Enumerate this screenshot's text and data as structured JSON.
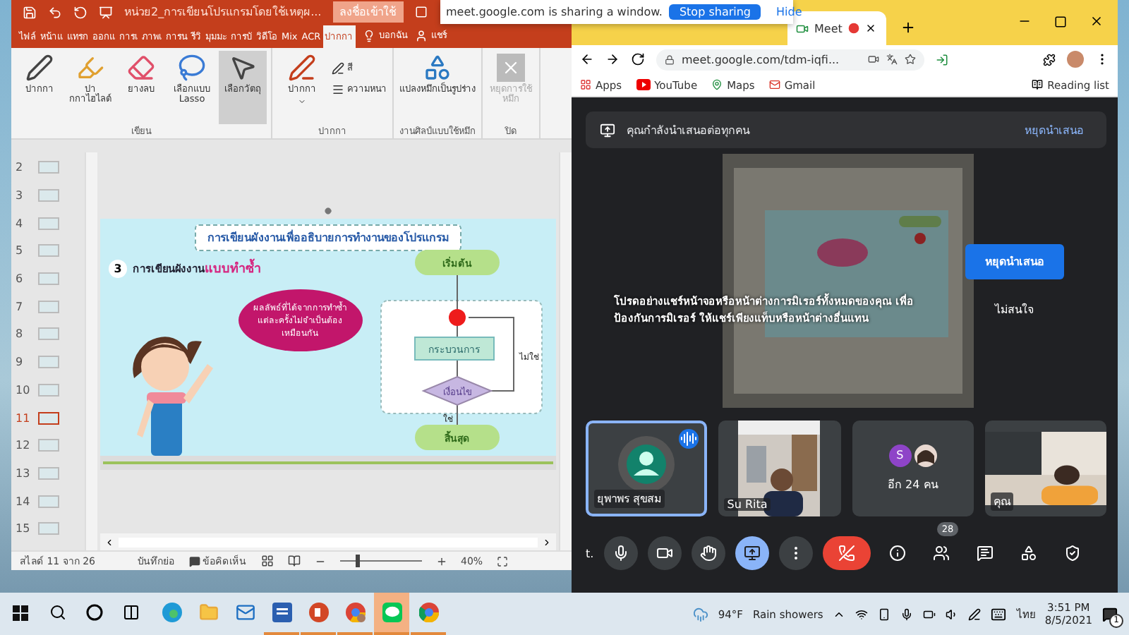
{
  "powerpoint": {
    "file_title": "หน่วย2_การเขียนโปรแกรมโดยใช้เหตุผ...",
    "sign_in": "ลงชื่อเข้าใช้",
    "tabs": [
      {
        "label": "ไฟล์",
        "selected": false
      },
      {
        "label": "หน้าแ",
        "selected": false
      },
      {
        "label": "แทรก",
        "selected": false
      },
      {
        "label": "ออกแ",
        "selected": false
      },
      {
        "label": "การเ",
        "selected": false
      },
      {
        "label": "ภาพเ",
        "selected": false
      },
      {
        "label": "การน",
        "selected": false
      },
      {
        "label": "รีวิ",
        "selected": false
      },
      {
        "label": "มุมมะ",
        "selected": false
      },
      {
        "label": "การบั",
        "selected": false
      },
      {
        "label": "วิดีโอ",
        "selected": false
      },
      {
        "label": "Mix",
        "selected": false
      },
      {
        "label": "ACR",
        "selected": false
      },
      {
        "label": "ปากกา",
        "selected": true
      }
    ],
    "tell_me": "บอกฉัน",
    "share": "แชร์",
    "ribbon_groups": [
      {
        "name": "เขียน",
        "tools": [
          {
            "label": "ปากกา",
            "kind": "pen",
            "selected": false,
            "disabled": false
          },
          {
            "label": "ปากกาไฮไลต์",
            "kind": "highlighter",
            "selected": false,
            "disabled": false
          },
          {
            "label": "ยางลบ",
            "kind": "eraser",
            "selected": false,
            "disabled": false
          },
          {
            "label": "เลือกแบบ Lasso",
            "kind": "lasso",
            "selected": false,
            "disabled": false
          },
          {
            "label": "เลือกวัตถุ",
            "kind": "select",
            "selected": true,
            "disabled": false
          }
        ]
      },
      {
        "name": "ปากกา",
        "tools": [
          {
            "label": "ปากกา",
            "kind": "pen_set",
            "selected": false,
            "disabled": false
          },
          {
            "label": "สี",
            "kind": "color",
            "selected": false,
            "disabled": false
          },
          {
            "label": "ความหนา",
            "kind": "thickness",
            "selected": false,
            "disabled": false
          }
        ]
      },
      {
        "name": "งานศิลป์แบบใช้หมึก",
        "tools": [
          {
            "label": "แปลงหมึกเป็นรูปร่าง",
            "kind": "convert",
            "selected": false,
            "disabled": false
          }
        ]
      },
      {
        "name": "ปิด",
        "tools": [
          {
            "label": "หยุดการใช้หมึก",
            "kind": "stop",
            "selected": false,
            "disabled": true
          }
        ]
      }
    ],
    "slides": [
      {
        "number": "2",
        "selected": false
      },
      {
        "number": "3",
        "selected": false
      },
      {
        "number": "4",
        "selected": false
      },
      {
        "number": "5",
        "selected": false
      },
      {
        "number": "6",
        "selected": false
      },
      {
        "number": "7",
        "selected": false
      },
      {
        "number": "8",
        "selected": false
      },
      {
        "number": "9",
        "selected": false
      },
      {
        "number": "10",
        "selected": false
      },
      {
        "number": "11",
        "selected": true
      },
      {
        "number": "12",
        "selected": false
      },
      {
        "number": "13",
        "selected": false
      },
      {
        "number": "14",
        "selected": false
      },
      {
        "number": "15",
        "selected": false
      }
    ],
    "slide": {
      "title": "การเขียนผังงานเพื่ออธิบายการทำงานของโปรแกรม",
      "step": "3",
      "heading": "การเขียนผังงาน",
      "heading_highlight": "แบบทำซ้ำ",
      "bubble": "ผลลัพธ์ที่ได้จากการทำซ้ำแต่ละครั้งไม่จำเป็นต้องเหมือนกัน",
      "flow_start": "เริ่มต้น",
      "flow_process": "กระบวนการ",
      "flow_condition": "เงื่อนไข",
      "flow_no": "ไม่ใช่",
      "flow_yes": "ใช่",
      "flow_end": "สิ้นสุด"
    },
    "status": {
      "slide_count": "สไลด์ 11 จาก 26",
      "notes": "บันทึกย่อ",
      "comments": "ข้อคิดเห็น",
      "zoom": "40%",
      "zoom_level": {
        "level": 0.2
      }
    }
  },
  "sharing_bar": {
    "message": "meet.google.com is sharing a window.",
    "stop": "Stop sharing",
    "hide": "Hide"
  },
  "chrome": {
    "tab": {
      "title": "Meet",
      "recording": true
    },
    "url": "meet.google.com/tdm-iqfi...",
    "bookmarks": [
      {
        "label": "Apps",
        "kind": "apps"
      },
      {
        "label": "YouTube",
        "kind": "youtube"
      },
      {
        "label": "Maps",
        "kind": "maps"
      },
      {
        "label": "Gmail",
        "kind": "gmail"
      }
    ],
    "reading_list": "Reading list"
  },
  "meet": {
    "banner": {
      "text": "คุณกำลังนำเสนอต่อทุกคน",
      "stop": "หยุดนำเสนอ"
    },
    "warning": {
      "text": "โปรดอย่างแชร์หน้าจอหรือหน้าต่างการมิเรอร์ทั้งหมดของคุณ เพื่อป้องกันการมิเรอร์ ให้แชร์เพียงแท็บหรือหน้าต่างอื่นแทน",
      "stop": "หยุดนำเสนอ",
      "dismiss": "ไม่สนใจ"
    },
    "tiles": [
      {
        "kind": "avatar",
        "name": "ยุพาพร สุขสม",
        "speaking": true
      },
      {
        "kind": "video",
        "name": "Su Rita",
        "speaking": false
      },
      {
        "kind": "group",
        "initial": "S",
        "name": "อีก 24 คน",
        "speaking": false
      },
      {
        "kind": "video",
        "name": "คุณ",
        "speaking": false
      }
    ],
    "caption_hint": "t.",
    "controls": [
      {
        "kind": "mic",
        "active": false
      },
      {
        "kind": "camera",
        "active": false
      },
      {
        "kind": "hand",
        "active": false
      },
      {
        "kind": "present",
        "active": true
      },
      {
        "kind": "more",
        "active": false
      },
      {
        "kind": "end",
        "active": false
      },
      {
        "kind": "info",
        "active": false
      },
      {
        "kind": "people",
        "active": false,
        "badge": "28"
      },
      {
        "kind": "chat",
        "active": false
      },
      {
        "kind": "activities",
        "active": false
      },
      {
        "kind": "safety",
        "active": false
      }
    ]
  },
  "taskbar": {
    "apps": [
      {
        "kind": "start",
        "running": false,
        "selected": false
      },
      {
        "kind": "search",
        "running": false,
        "selected": false
      },
      {
        "kind": "cortana",
        "running": false,
        "selected": false
      },
      {
        "kind": "taskview",
        "running": false,
        "selected": false
      },
      {
        "kind": "edge",
        "running": false,
        "selected": false
      },
      {
        "kind": "explorer",
        "running": false,
        "selected": false
      },
      {
        "kind": "mail",
        "running": false,
        "selected": false
      },
      {
        "kind": "word",
        "running": true,
        "selected": false
      },
      {
        "kind": "powerpoint",
        "running": true,
        "selected": false
      },
      {
        "kind": "chrome_profile",
        "running": true,
        "selected": false
      },
      {
        "kind": "line",
        "running": true,
        "selected": true
      },
      {
        "kind": "chrome",
        "running": true,
        "selected": false
      }
    ],
    "weather": {
      "temp": "94°F",
      "condition": "Rain showers"
    },
    "language": "ไทย",
    "time": "3:51 PM",
    "date": "8/5/2021",
    "notifications": "1"
  }
}
